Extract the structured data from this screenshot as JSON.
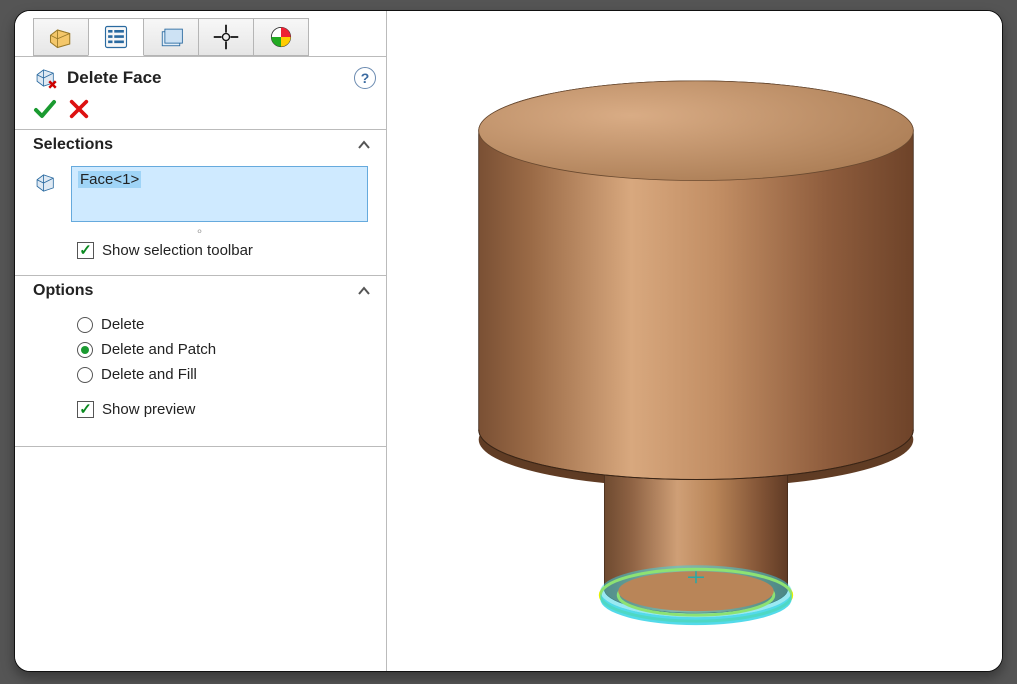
{
  "feature": {
    "title": "Delete Face"
  },
  "selections": {
    "header": "Selections",
    "items": [
      "Face<1>"
    ],
    "show_toolbar_label": "Show selection toolbar",
    "show_toolbar_checked": true
  },
  "options": {
    "header": "Options",
    "items": [
      {
        "label": "Delete",
        "checked": false
      },
      {
        "label": "Delete and Patch",
        "checked": true
      },
      {
        "label": "Delete and Fill",
        "checked": false
      }
    ],
    "show_preview_label": "Show preview",
    "show_preview_checked": true
  }
}
